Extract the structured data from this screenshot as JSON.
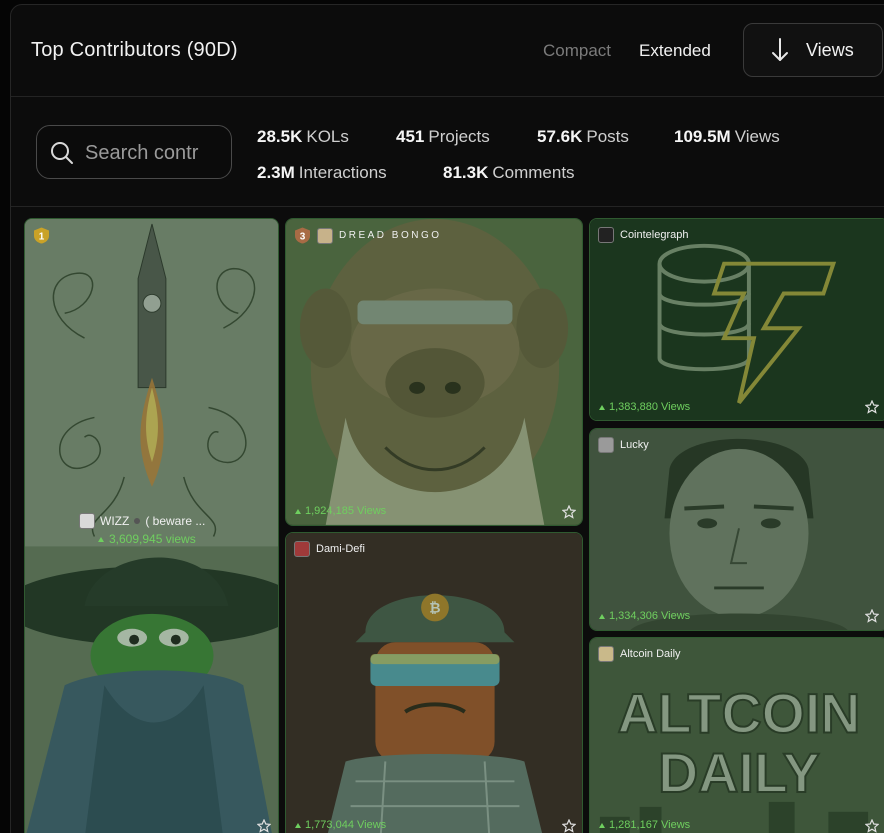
{
  "header": {
    "title": "Top Contributors (90D)",
    "mode_compact": "Compact",
    "mode_extended": "Extended",
    "sort_label": "Views"
  },
  "search": {
    "placeholder": "Search contr"
  },
  "stats": [
    {
      "value": "28.5K",
      "label": "KOLs"
    },
    {
      "value": "451",
      "label": "Projects"
    },
    {
      "value": "57.6K",
      "label": "Posts"
    },
    {
      "value": "109.5M",
      "label": "Views"
    },
    {
      "value": "2.3M",
      "label": "Interactions"
    },
    {
      "value": "81.3K",
      "label": "Comments"
    }
  ],
  "cards": [
    {
      "rank": "1",
      "name": "WIZZ",
      "name_extra": "( beware ...",
      "views": "3,609,945 views",
      "art": "rocket-and-pepe-wizard"
    },
    {
      "rank": "3",
      "name": "DREAD BONGO",
      "views": "1,924,185 Views",
      "art": "ape-blindfold"
    },
    {
      "name": "Dami-Defi",
      "views": "1,773,044 Views",
      "art": "ape-cap-goggles"
    },
    {
      "name": "Cointelegraph",
      "views": "1,383,880 Views",
      "art": "coin-bolt-logo"
    },
    {
      "name": "Lucky",
      "views": "1,334,306 Views",
      "art": "portrait"
    },
    {
      "name": "Altcoin Daily",
      "views": "1,281,167 Views",
      "art": "altcoin-daily-text",
      "art_text_1": "ALTCOIN",
      "art_text_2": "DAILY"
    }
  ],
  "colors": {
    "accent_green": "#6fcf5f",
    "card_border": "#2f5a30",
    "gold_rank": "#c9a227",
    "bronze_rank": "#a86b45"
  }
}
